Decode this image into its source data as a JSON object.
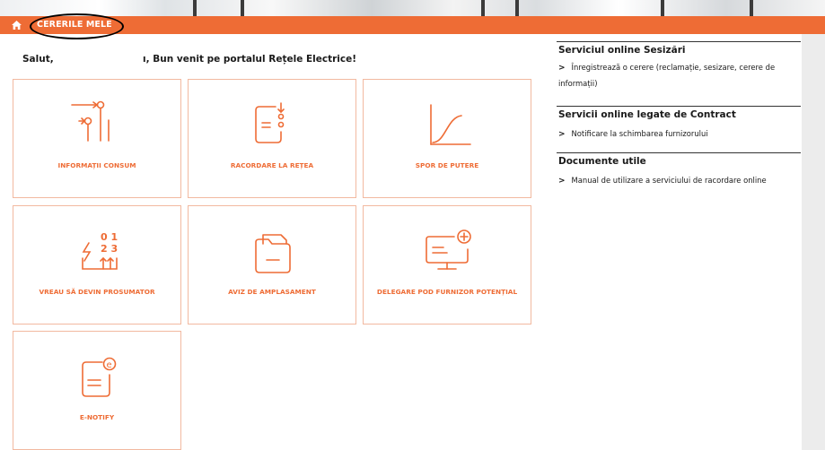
{
  "breadcrumb": {
    "label": "CERERILE MELE"
  },
  "greeting": {
    "prefix": "Salut,",
    "suffix": "ı, Bun venit pe portalul Rețele Electrice!"
  },
  "tiles": [
    {
      "label": "INFORMAȚII CONSUM",
      "icon": "consumption-info-icon"
    },
    {
      "label": "RACORDARE LA REȚEA",
      "icon": "grid-connection-icon"
    },
    {
      "label": "SPOR DE PUTERE",
      "icon": "power-increase-icon"
    },
    {
      "label": "VREAU SĂ DEVIN PROSUMATOR",
      "icon": "prosumer-icon"
    },
    {
      "label": "AVIZ DE AMPLASAMENT",
      "icon": "folder-icon"
    },
    {
      "label": "DELEGARE POD FURNIZOR POTENȚIAL",
      "icon": "monitor-add-icon"
    },
    {
      "label": "E-NOTIFY",
      "icon": "e-notify-icon"
    }
  ],
  "side": {
    "sections": [
      {
        "title": "Serviciul online Sesizări",
        "links": [
          "Înregistrează o cerere (reclamație, sesizare, cerere de informații)"
        ]
      },
      {
        "title": "Servicii online legate de Contract",
        "links": [
          "Notificare la schimbarea furnizorului"
        ]
      },
      {
        "title": "Documente utile",
        "links": [
          "Manual de utilizare a serviciului de racordare online"
        ]
      }
    ]
  },
  "colors": {
    "accent": "#ee6c35",
    "tile_border": "#f2b9a0"
  }
}
